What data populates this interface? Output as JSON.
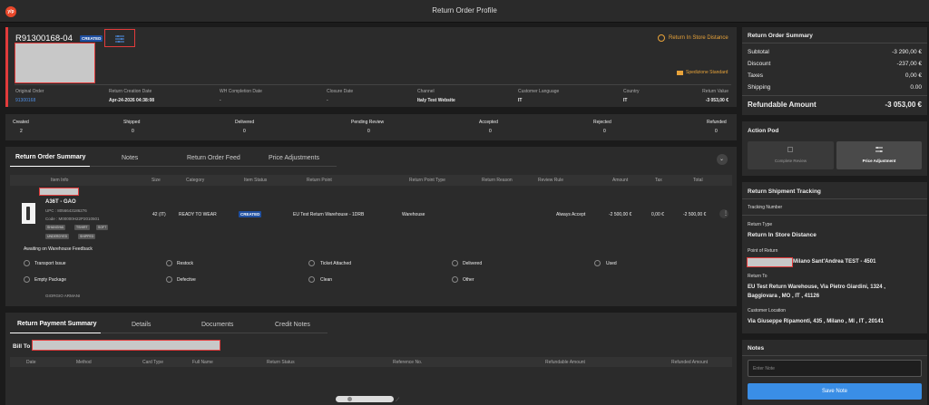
{
  "app": {
    "logo": "y/p",
    "title": "Return Order Profile"
  },
  "order": {
    "id": "R91300168-04",
    "status": "CREATED",
    "return_location": "Return In Store Distance",
    "shipping": "Spedizione Standard"
  },
  "order_details": [
    {
      "label": "Original Order",
      "value": "91300168"
    },
    {
      "label": "Return Creation Date",
      "value": "Apr-24-2026 04:38:08"
    },
    {
      "label": "WH Completion Date",
      "value": "-"
    },
    {
      "label": "Closure Date",
      "value": "-"
    },
    {
      "label": "Channel",
      "value": "Italy Test Website"
    },
    {
      "label": "Customer Language",
      "value": "IT"
    },
    {
      "label": "Country",
      "value": "IT"
    },
    {
      "label": "Return Value",
      "value": "-3 053,00 €"
    }
  ],
  "counts": [
    {
      "label": "Created",
      "value": "2"
    },
    {
      "label": "Shipped",
      "value": "0"
    },
    {
      "label": "Delivered",
      "value": "0"
    },
    {
      "label": "Pending Review",
      "value": "0"
    },
    {
      "label": "Accepted",
      "value": "0"
    },
    {
      "label": "Rejected",
      "value": "0"
    },
    {
      "label": "Refunded",
      "value": "0"
    }
  ],
  "tabs1": [
    "Return Order Summary",
    "Notes",
    "Return Order Feed",
    "Price Adjustments"
  ],
  "table1": {
    "headers": [
      "Item Info",
      "Size",
      "Category",
      "Item Status",
      "Return Point",
      "Return Point Type",
      "Return Reason",
      "Review Rule",
      "Amount",
      "Tax",
      "Total"
    ],
    "item": {
      "name": "A36T - GAO",
      "upc": "UPC : 8056643186276",
      "code": "Code : M00000H22P2010501",
      "size": "42 (IT)",
      "category": "READY TO WEAR",
      "status": "CREATED",
      "return_point": "EU Test Return Warehouse - 1DRB",
      "return_point_type": "Warehouse",
      "review_rule": "Always Accept",
      "amount": "-2 500,00 €",
      "tax": "0,00 €",
      "total": "-2 500,00 €",
      "tags": [
        "SHANGHAI",
        "TSHIRT",
        "SOFT",
        "UNDERDYED",
        "SHIPPED"
      ],
      "brand": "GIORGIO ARMANI"
    }
  },
  "feedback": {
    "title": "Awaiting on Warehouse Feedback",
    "options": [
      "Transport Issue",
      "Restock",
      "Ticket Attached",
      "Delivered",
      "Used",
      "Empty Package",
      "Defective",
      "Clean",
      "Other"
    ]
  },
  "tabs2": [
    "Return Payment Summary",
    "Details",
    "Documents",
    "Credit Notes"
  ],
  "payment": {
    "bill_to": "Bill To :",
    "headers": [
      "Date",
      "Method",
      "Card Type",
      "Full Name",
      "Return Status",
      "Reference No.",
      "Refundable Amount",
      "Refunded Amount"
    ]
  },
  "summary": {
    "title": "Return Order Summary",
    "rows": [
      {
        "label": "Subtotal",
        "value": "-3 290,00 €"
      },
      {
        "label": "Discount",
        "value": "-237,00 €"
      },
      {
        "label": "Taxes",
        "value": "0,00 €"
      },
      {
        "label": "Shipping",
        "value": "0.00"
      }
    ],
    "total_label": "Refundable Amount",
    "total_value": "-3 053,00 €"
  },
  "action_pod": {
    "title": "Action Pod",
    "complete": "Complete Review",
    "price": "Price Adjustment"
  },
  "shipment": {
    "title": "Return Shipment Tracking",
    "tracking_label": "Tracking Number",
    "type_label": "Return Type",
    "type_value": "Return In Store Distance",
    "por_label": "Point of Return",
    "por_value": "Milano Sant'Andrea TEST - 4501",
    "return_to_label": "Return To",
    "return_to_value1": "EU Test Return Warehouse, Via Pietro Giardini, 1324 ,",
    "return_to_value2": "Baggiovara , MO , IT , 41126",
    "customer_loc_label": "Customer Location",
    "customer_loc_value": "Via Giuseppe Ripamonti, 435 , Milano , MI , IT , 20141"
  },
  "notes": {
    "title": "Notes",
    "placeholder": "Enter Note",
    "save": "Save Note"
  }
}
